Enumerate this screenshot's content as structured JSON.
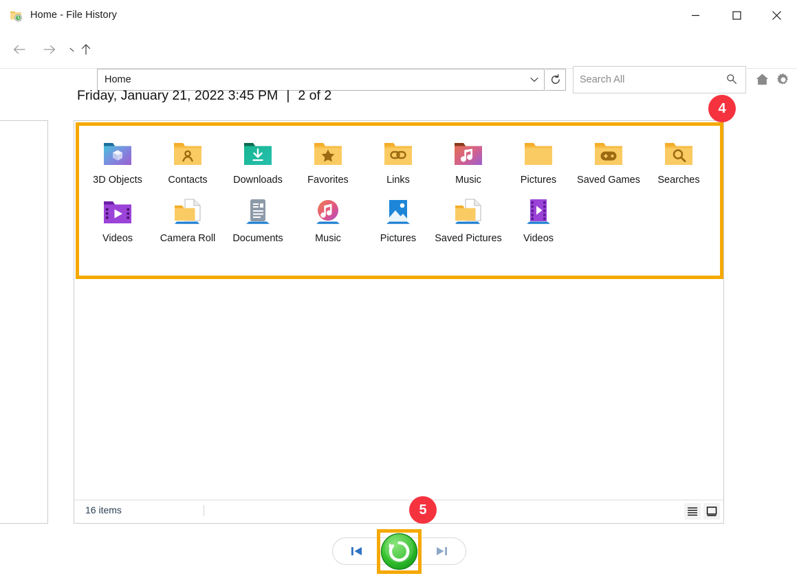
{
  "window": {
    "title": "Home - File History",
    "title_icon": "folder-history-icon",
    "controls": {
      "minimize": "—",
      "maximize": "□",
      "close": "✕"
    }
  },
  "toolbar": {
    "back_icon": "arrow-left-icon",
    "forward_icon": "arrow-right-icon",
    "recent_icon": "recent-locations-icon",
    "up_icon": "arrow-up-icon",
    "address_value": "Home",
    "address_chevron": "⌄",
    "refresh_icon": "refresh-icon",
    "search_placeholder": "Search All",
    "search_value": "",
    "search_icon": "search-icon",
    "home_icon": "home-icon",
    "gear_icon": "gear-icon"
  },
  "header": {
    "date": "Friday, January 21, 2022 3:45 PM",
    "separator": "|",
    "count": "2 of 2"
  },
  "content": {
    "items": [
      {
        "label": "3D Objects",
        "icon": "folder-3dobjects-icon"
      },
      {
        "label": "Contacts",
        "icon": "folder-contacts-icon"
      },
      {
        "label": "Downloads",
        "icon": "folder-downloads-icon"
      },
      {
        "label": "Favorites",
        "icon": "folder-favorites-icon"
      },
      {
        "label": "Links",
        "icon": "folder-links-icon"
      },
      {
        "label": "Music",
        "icon": "folder-music-icon"
      },
      {
        "label": "Pictures",
        "icon": "folder-plain-icon"
      },
      {
        "label": "Saved Games",
        "icon": "folder-savedgames-icon"
      },
      {
        "label": "Searches",
        "icon": "folder-searches-icon"
      },
      {
        "label": "Videos",
        "icon": "library-videos-icon"
      },
      {
        "label": "Camera Roll",
        "icon": "library-cameraroll-icon"
      },
      {
        "label": "Documents",
        "icon": "library-documents-icon"
      },
      {
        "label": "Music",
        "icon": "library-music-icon"
      },
      {
        "label": "Pictures",
        "icon": "library-pictures-icon"
      },
      {
        "label": "Saved Pictures",
        "icon": "library-savedpictures-icon"
      },
      {
        "label": "Videos",
        "icon": "library-videos2-icon"
      }
    ]
  },
  "statusbar": {
    "item_count": "16 items",
    "view_details_icon": "details-view-icon",
    "view_large_icon": "large-icons-view-icon"
  },
  "bottom_nav": {
    "previous_icon": "previous-version-icon",
    "restore_icon": "restore-icon",
    "next_icon": "next-version-icon"
  },
  "callouts": [
    {
      "number": "4"
    },
    {
      "number": "5"
    }
  ],
  "colors": {
    "accent_highlight": "#f5a800",
    "badge": "#f5333f",
    "restore_green": "#35c13a",
    "folder_yellow": "#f7c55b"
  }
}
